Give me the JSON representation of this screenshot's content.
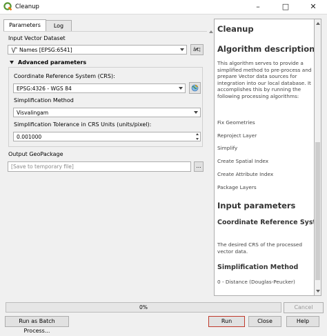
{
  "window": {
    "title": "Cleanup"
  },
  "tabs": [
    {
      "label": "Parameters",
      "active": true
    },
    {
      "label": "Log",
      "active": false
    }
  ],
  "params": {
    "input_label": "Input Vector Dataset",
    "input_value": "Names [EPSG:6541]",
    "input_icon": "line-layer-icon",
    "iterate_label": "â€¦",
    "advanced_label": "Advanced parameters",
    "crs_label": "Coordinate Reference System (CRS):",
    "crs_value": "EPSG:4326 - WGS 84",
    "simp_label": "Simplification Method",
    "simp_value": "Visvalingam",
    "tol_label": "Simplification Tolerance in CRS Units (units/pixel):",
    "tol_value": "0.001000",
    "output_label": "Output GeoPackage",
    "output_placeholder": "[Save to temporary file]",
    "browse_label": "..."
  },
  "help": {
    "title": "Cleanup",
    "desc_heading": "Algorithm description",
    "desc_text": "This algorithm serves to provide a simplified method to pre-process and prepare Vector data sources for integration into our local database. It accomplishes this by running the following processing algorithms:",
    "steps": [
      "Fix Geometries",
      "Reproject Layer",
      "Simplify",
      "Create Spatial Index",
      "Create Attribute Index",
      "Package Layers"
    ],
    "input_heading": "Input parameters",
    "crs_heading": "Coordinate Reference System (CRS):",
    "crs_text": "The desired CRS of the processed vector data.",
    "simp_heading": "Simplification Method",
    "simp_text": "0 - Distance (Douglas-Peucker)"
  },
  "progress": {
    "label": "0%",
    "value": 0
  },
  "buttons": {
    "cancel": "Cancel",
    "batch": "Run as Batch Process...",
    "run": "Run",
    "close": "Close",
    "help": "Help"
  },
  "colors": {
    "accent": "#3c78c6",
    "progress_fill": "#06b025",
    "run_border": "#c0392b",
    "qgis_green": "#589632",
    "qgis_yellow": "#ee7913"
  }
}
